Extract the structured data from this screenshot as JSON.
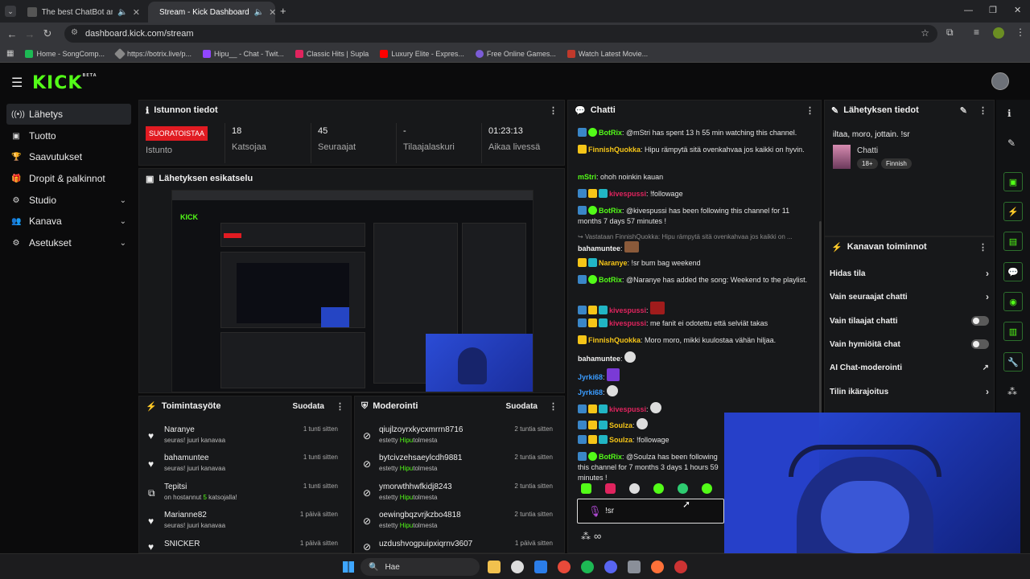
{
  "browser": {
    "tabs": [
      {
        "title": "The best ChatBot and Widg",
        "active": false
      },
      {
        "title": "Stream - Kick Dashboard",
        "active": true
      }
    ],
    "url": "dashboard.kick.com/stream",
    "bookmarks": [
      "Home - SongComp...",
      "https://botrix.live/p...",
      "Hipu__ - Chat - Twit...",
      "Classic Hits | Supla",
      "Luxury Elite - Expres...",
      "Free Online Games...",
      "Watch Latest Movie..."
    ]
  },
  "app": {
    "logo": "KICK",
    "logo_badge": "BETA",
    "sidebar": [
      {
        "label": "Lähetys",
        "icon": "broadcast-icon"
      },
      {
        "label": "Tuotto",
        "icon": "wallet-icon"
      },
      {
        "label": "Saavutukset",
        "icon": "trophy-icon"
      },
      {
        "label": "Dropit & palkinnot",
        "icon": "gift-icon"
      },
      {
        "label": "Studio",
        "icon": "studio-icon"
      },
      {
        "label": "Kanava",
        "icon": "people-icon"
      },
      {
        "label": "Asetukset",
        "icon": "gear-icon"
      }
    ]
  },
  "session": {
    "title": "Istunnon tiedot",
    "live_label": "SUORATOISTAA",
    "status_label": "Istunto",
    "stats": [
      {
        "value": "18",
        "label": "Katsojaa"
      },
      {
        "value": "45",
        "label": "Seuraajat"
      },
      {
        "value": "-",
        "label": "Tilaajalaskuri"
      },
      {
        "value": "01:23:13",
        "label": "Aikaa livessä"
      }
    ]
  },
  "preview": {
    "title": "Lähetyksen esikatselu"
  },
  "activity": {
    "title": "Toimintasyöte",
    "filter": "Suodata",
    "items": [
      {
        "name": "Naranye",
        "sub": "seuras! juuri kanavaa",
        "time": "1 tunti sitten",
        "icon": "heart-icon"
      },
      {
        "name": "bahamuntee",
        "sub": "seuras! juuri kanavaa",
        "time": "1 tunti sitten",
        "icon": "heart-icon"
      },
      {
        "name": "Tepitsi",
        "sub_prefix": "on hostannut ",
        "sub_num": "5",
        "sub_suffix": " katsojalla!",
        "time": "1 tunti sitten",
        "icon": "host-icon"
      },
      {
        "name": "Marianne82",
        "sub": "seuras! juuri kanavaa",
        "time": "1 päivä sitten",
        "icon": "heart-icon"
      },
      {
        "name": "SNICKER",
        "sub": "",
        "time": "1 päivä sitten",
        "icon": "heart-icon"
      }
    ]
  },
  "moderation": {
    "title": "Moderointi",
    "filter": "Suodata",
    "items": [
      {
        "name": "qiujlzoyrxkycxmrrn8716",
        "sub_prefix": "estetty ",
        "sub_name": "Hipu",
        "sub_suffix": "tolmesta",
        "time": "2 tuntia sitten"
      },
      {
        "name": "bytcivzehsaeylcdh9881",
        "sub_prefix": "estetty ",
        "sub_name": "Hipu",
        "sub_suffix": "tolmesta",
        "time": "2 tuntia sitten"
      },
      {
        "name": "ymorwthhwfkidj8243",
        "sub_prefix": "estetty ",
        "sub_name": "Hipu",
        "sub_suffix": "tolmesta",
        "time": "2 tuntia sitten"
      },
      {
        "name": "oewingbqzvrjkzbo4818",
        "sub_prefix": "estetty ",
        "sub_name": "Hipu",
        "sub_suffix": "tolmesta",
        "time": "2 tuntia sitten"
      },
      {
        "name": "uzdushvogpuipxiqrnv3607",
        "sub_prefix": "",
        "sub_name": "",
        "sub_suffix": "",
        "time": "1 päivä sitten"
      }
    ]
  },
  "chat": {
    "title": "Chatti",
    "input_value": "!sr",
    "lines": [
      {
        "user": "BotRix",
        "color": "#53fc18",
        "badges": "bot",
        "text": "@mStri has spent 13 h 55 min watching this channel."
      },
      {
        "user": "FinnishQuokka",
        "color": "#f5c518",
        "badges": "crown",
        "text": "Hipu rämpytä sitä ovenkahvaa jos kaikki on hyvin."
      },
      {
        "user": "mStri",
        "color": "#53fc18",
        "badges": "",
        "text": "ohoh noinkin kauan"
      },
      {
        "user": "kivespussi",
        "color": "#e0245e",
        "badges": "mod",
        "text": "!followage"
      },
      {
        "user": "BotRix",
        "color": "#53fc18",
        "badges": "bot",
        "text": "@kivespussi has been following this channel for 11 months 7 days 57 minutes !"
      },
      {
        "reply": "Vastataan FinnishQuokka: Hipu rämpytä sitä ovenkahvaa jos kaikki on ...",
        "user": "bahamuntee",
        "color": "#f0f0f0",
        "badges": "",
        "text": ""
      },
      {
        "user": "Naranye",
        "color": "#f5c518",
        "badges": "crown",
        "text": "!sr bum bag weekend"
      },
      {
        "user": "BotRix",
        "color": "#53fc18",
        "badges": "bot",
        "text": "@Naranye has added the song: Weekend to the playlist."
      },
      {
        "user": "kivespussi",
        "color": "#e0245e",
        "badges": "mod",
        "text": ""
      },
      {
        "user": "kivespussi",
        "color": "#e0245e",
        "badges": "mod",
        "text": "me fanit ei odotettu että selviät takas"
      },
      {
        "user": "FinnishQuokka",
        "color": "#f5c518",
        "badges": "crown",
        "text": "Moro moro, mikki kuulostaa vähän hiljaa."
      },
      {
        "user": "bahamuntee",
        "color": "#f0f0f0",
        "badges": "",
        "text": ""
      },
      {
        "user": "Jyrki68",
        "color": "#3a9cff",
        "badges": "",
        "text": ""
      },
      {
        "user": "Jyrki68",
        "color": "#3a9cff",
        "badges": "",
        "text": ""
      },
      {
        "user": "kivespussi",
        "color": "#e0245e",
        "badges": "mod",
        "text": ""
      },
      {
        "user": "Soulza",
        "color": "#f5c518",
        "badges": "mod",
        "text": ""
      },
      {
        "user": "Soulza",
        "color": "#f5c518",
        "badges": "mod",
        "text": "!followage"
      },
      {
        "user": "BotRix",
        "color": "#53fc18",
        "badges": "bot",
        "text": "@Soulza has been following this channel for 7 months 3 days 1 hours 59 minutes !"
      }
    ]
  },
  "stream_info": {
    "title": "Lähetyksen tiedot",
    "stream_title": "iltaa, moro, jottain. !sr",
    "category": "Chatti",
    "tags": [
      "18+",
      "Finnish"
    ]
  },
  "channel_actions": {
    "title": "Kanavan toiminnot",
    "items": [
      {
        "label": "Hidas tila",
        "control": "chevron"
      },
      {
        "label": "Vain seuraajat chatti",
        "control": "chevron"
      },
      {
        "label": "Vain tilaajat chatti",
        "control": "toggle"
      },
      {
        "label": "Vain hymiöitä chat",
        "control": "toggle"
      },
      {
        "label": "AI Chat-moderointi",
        "control": "external"
      },
      {
        "label": "Tilin ikärajoitus",
        "control": "chevron"
      }
    ]
  },
  "taskbar": {
    "search": "Hae"
  }
}
